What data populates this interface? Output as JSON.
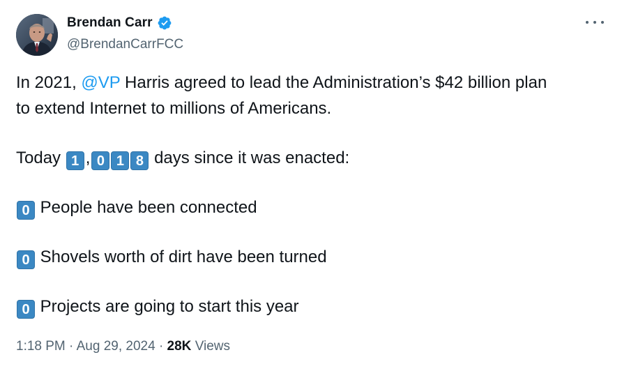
{
  "author": {
    "name": "Brendan Carr",
    "handle": "@BrendanCarrFCC",
    "verified_badge_color": "#1d9bf0"
  },
  "menu_icon": "more-horizontal-icon",
  "tweet": {
    "line1_prefix": "In 2021, ",
    "mention": "@VP",
    "line1_suffix": " Harris agreed to lead the Administration’s $42 billion plan",
    "line2": "to extend Internet to millions of Americans.",
    "today_label": "Today",
    "day_digits": [
      "1",
      "0",
      "1",
      "8"
    ],
    "digit_separator": ",",
    "days_suffix": "days since it was enacted:",
    "stats": [
      {
        "value": "0",
        "text": "People have been connected"
      },
      {
        "value": "0",
        "text": "Shovels worth of dirt have been turned"
      },
      {
        "value": "0",
        "text": "Projects are going to start this year"
      }
    ]
  },
  "meta": {
    "time": "1:18 PM",
    "separator": "·",
    "date": "Aug 29, 2024",
    "views_count": "28K",
    "views_label": "Views"
  },
  "colors": {
    "link": "#1d9bf0",
    "keycap": "#3b88c3",
    "muted": "#536471",
    "text": "#0f1419"
  }
}
